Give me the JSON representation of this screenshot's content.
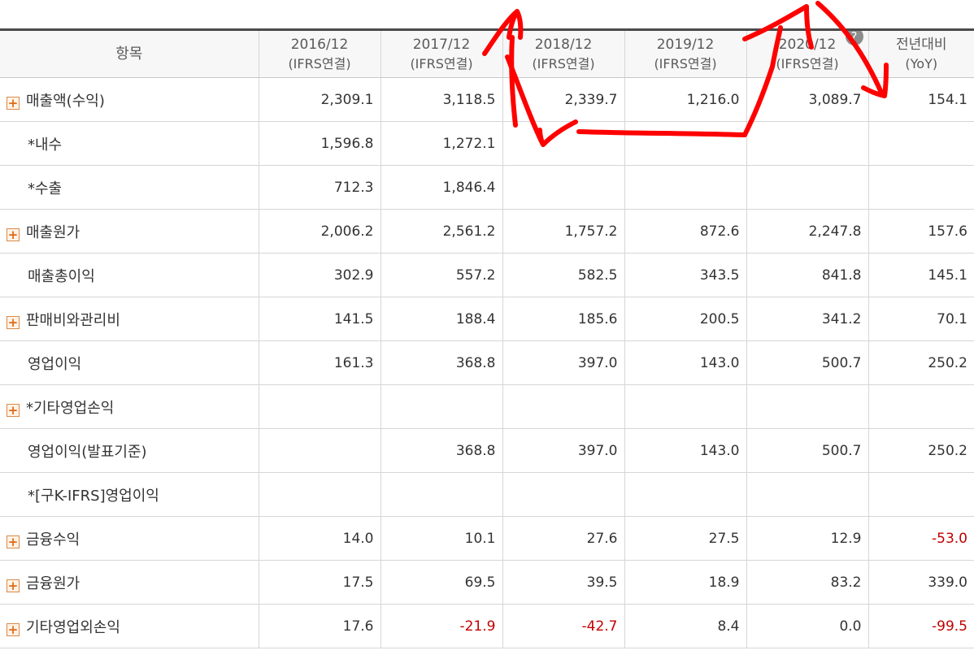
{
  "header": {
    "item": "항목",
    "columns": [
      {
        "year": "2016/12",
        "basis": "(IFRS연결)"
      },
      {
        "year": "2017/12",
        "basis": "(IFRS연결)"
      },
      {
        "year": "2018/12",
        "basis": "(IFRS연결)"
      },
      {
        "year": "2019/12",
        "basis": "(IFRS연결)"
      },
      {
        "year": "2020/12",
        "basis": "(IFRS연결)"
      }
    ],
    "yoy": {
      "title": "전년대비",
      "sub": "(YoY)"
    }
  },
  "rows": [
    {
      "label": "매출액(수익)",
      "expandable": true,
      "values": [
        "2,309.1",
        "3,118.5",
        "2,339.7",
        "1,216.0",
        "3,089.7",
        "154.1"
      ]
    },
    {
      "label": "*내수",
      "expandable": false,
      "values": [
        "1,596.8",
        "1,272.1",
        "",
        "",
        "",
        ""
      ]
    },
    {
      "label": "*수출",
      "expandable": false,
      "values": [
        "712.3",
        "1,846.4",
        "",
        "",
        "",
        ""
      ]
    },
    {
      "label": "매출원가",
      "expandable": true,
      "values": [
        "2,006.2",
        "2,561.2",
        "1,757.2",
        "872.6",
        "2,247.8",
        "157.6"
      ]
    },
    {
      "label": "매출총이익",
      "expandable": false,
      "values": [
        "302.9",
        "557.2",
        "582.5",
        "343.5",
        "841.8",
        "145.1"
      ]
    },
    {
      "label": "판매비와관리비",
      "expandable": true,
      "values": [
        "141.5",
        "188.4",
        "185.6",
        "200.5",
        "341.2",
        "70.1"
      ]
    },
    {
      "label": "영업이익",
      "expandable": false,
      "values": [
        "161.3",
        "368.8",
        "397.0",
        "143.0",
        "500.7",
        "250.2"
      ]
    },
    {
      "label": "*기타영업손익",
      "expandable": true,
      "values": [
        "",
        "",
        "",
        "",
        "",
        ""
      ]
    },
    {
      "label": "영업이익(발표기준)",
      "expandable": false,
      "values": [
        "",
        "368.8",
        "397.0",
        "143.0",
        "500.7",
        "250.2"
      ]
    },
    {
      "label": "*[구K-IFRS]영업이익",
      "expandable": false,
      "values": [
        "",
        "",
        "",
        "",
        "",
        ""
      ]
    },
    {
      "label": "금융수익",
      "expandable": true,
      "values": [
        "14.0",
        "10.1",
        "27.6",
        "27.5",
        "12.9",
        "-53.0"
      ]
    },
    {
      "label": "금융원가",
      "expandable": true,
      "values": [
        "17.5",
        "69.5",
        "39.5",
        "18.9",
        "83.2",
        "339.0"
      ]
    },
    {
      "label": "기타영업외손익",
      "expandable": true,
      "values": [
        "17.6",
        "-21.9",
        "-42.7",
        "8.4",
        "0.0",
        "-99.5"
      ]
    }
  ],
  "colors": {
    "negative": "#c00000",
    "annotation": "#ff0000",
    "header_bg": "#f7f7f7",
    "plus_icon": "#e06a14"
  },
  "icons": {
    "expand": "plus-box-icon",
    "info": "info-circle-icon"
  }
}
